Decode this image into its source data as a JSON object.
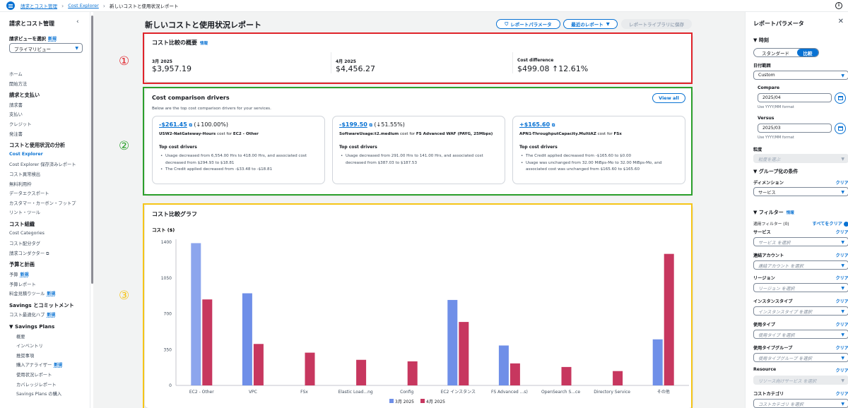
{
  "breadcrumbs": [
    "請求とコスト管理",
    "Cost Explorer",
    "新しいコストと使用状況レポート"
  ],
  "sidebar": {
    "title": "請求とコスト管理",
    "view_label": "請求ビューを選択",
    "new_badge": "新規",
    "view_value": "プライマリビュー",
    "items": [
      {
        "t": "ホーム",
        "k": "i"
      },
      {
        "t": "開始方法",
        "k": "i"
      },
      {
        "t": "請求と支払い",
        "k": "h"
      },
      {
        "t": "請求書",
        "k": "i"
      },
      {
        "t": "支払い",
        "k": "i"
      },
      {
        "t": "クレジット",
        "k": "i"
      },
      {
        "t": "発注書",
        "k": "i"
      },
      {
        "t": "コストと使用状況の分析",
        "k": "h"
      },
      {
        "t": "Cost Explorer",
        "k": "a"
      },
      {
        "t": "Cost Explorer 保存済みレポート",
        "k": "i"
      },
      {
        "t": "コスト異常検出",
        "k": "i"
      },
      {
        "t": "無料利用枠",
        "k": "i"
      },
      {
        "t": "データエクスポート",
        "k": "i"
      },
      {
        "t": "カスタマー・カーボン・フットプ",
        "k": "i"
      },
      {
        "t": "リント・ツール",
        "k": "i"
      },
      {
        "t": "コスト組織",
        "k": "h"
      },
      {
        "t": "Cost Categories",
        "k": "i"
      },
      {
        "t": "コスト配分タグ",
        "k": "i"
      },
      {
        "t": "請求コンダクター",
        "k": "e"
      },
      {
        "t": "予算と計画",
        "k": "h"
      },
      {
        "t": "予算",
        "k": "n"
      },
      {
        "t": "予算レポート",
        "k": "i"
      },
      {
        "t": "料金見積りツール",
        "k": "n"
      },
      {
        "t": "Savings とコミットメント",
        "k": "h"
      },
      {
        "t": "コスト最適化ハブ",
        "k": "n"
      },
      {
        "t": "▼ Savings Plans",
        "k": "hs"
      },
      {
        "t": "概要",
        "k": "s"
      },
      {
        "t": "インベントリ",
        "k": "s"
      },
      {
        "t": "推奨事項",
        "k": "s"
      },
      {
        "t": "購入アナライザー",
        "k": "sn"
      },
      {
        "t": "使用状況レポート",
        "k": "s"
      },
      {
        "t": "カバレッジレポート",
        "k": "s"
      },
      {
        "t": "Savings Plans の購入",
        "k": "s"
      }
    ]
  },
  "page": {
    "title": "新しいコストと使用状況レポート",
    "btn_params": "レポートパラメータ",
    "btn_recent": "最近のレポート",
    "btn_save": "レポートライブラリに保存"
  },
  "annotations": {
    "one": "①",
    "two": "②",
    "three": "③",
    "colors": {
      "one": "#e0242b",
      "two": "#2ca02c",
      "three": "#f5c518"
    }
  },
  "summary": {
    "title": "コスト比較の概要",
    "info": "情報",
    "cols": [
      {
        "label": "3月 2025",
        "value": "$3,957.19"
      },
      {
        "label": "4月 2025",
        "value": "$4,456.27"
      },
      {
        "label": "Cost difference",
        "value": "$499.08 ↑12.61%"
      }
    ]
  },
  "drivers": {
    "title": "Cost comparison drivers",
    "subtitle": "Below are the top cost comparison drivers for your services.",
    "view_all": "View all",
    "section": "Top cost drivers",
    "cards": [
      {
        "amount": "-$261.45",
        "pct": " (↓100.00%)",
        "usage": "USW2-NatGateway-Hours",
        "cost_for": " cost for ",
        "service": "EC2 - Other",
        "bullets": [
          "Usage decreased from 6,554.00 Hrs to 418.00 Hrs, and associated cost decreased from $294.93 to $18.81",
          "The Credit applied decreased from -$33.48 to -$18.81"
        ]
      },
      {
        "amount": "-$199.50",
        "pct": " (↓51.55%)",
        "usage": "SoftwareUsage:t2.medium",
        "cost_for": " cost for ",
        "service": "FS Advanced WAF (PAYG, 25Mbps)",
        "bullets": [
          "Usage decreased from 291.00 Hrs to 141.00 Hrs, and associated cost decreased from $387.03 to $187.53"
        ]
      },
      {
        "amount": "+$165.60",
        "pct": "",
        "usage": "APN1-ThroughputCapacity.MultiAZ",
        "cost_for": " cost for ",
        "service": "FSx",
        "bullets": [
          "The Credit applied decreased from -$165.60 to $0.00",
          "Usage was unchanged from 32.00 MiBps-Mo to 32.00 MiBps-Mo, and associated cost was unchanged from $165.60 to $165.60"
        ]
      }
    ]
  },
  "chart_card": {
    "title": "コスト比較グラフ"
  },
  "chart_data": {
    "type": "bar",
    "ylabel": "コスト ($)",
    "ylim": [
      0,
      1400
    ],
    "yticks": [
      0,
      350,
      700,
      1050,
      1400
    ],
    "categories": [
      "EC2 - Other",
      "VPC",
      "FSx",
      "Elastic Load...ng",
      "Config",
      "EC2 インスタンス",
      "FS Advanced ...s)",
      "OpenSearch S...ce",
      "Directory Service",
      "その他"
    ],
    "series": [
      {
        "name": "3月 2025",
        "color": "#6f8fe8",
        "values": [
          1390,
          900,
          0,
          0,
          0,
          835,
          390,
          0,
          0,
          450
        ]
      },
      {
        "name": "4月 2025",
        "color": "#c7375f",
        "values": [
          840,
          405,
          320,
          250,
          235,
          620,
          215,
          180,
          140,
          1285
        ]
      }
    ],
    "grid": false,
    "legend": "bottom"
  },
  "right_panel": {
    "title": "レポートパラメータ",
    "time_h": "時刻",
    "seg": [
      "スタンダード",
      "比較"
    ],
    "date_range_l": "日付範囲",
    "date_range_v": "Custom",
    "compare_l": "Compare",
    "compare_v": "2025/04",
    "versus_l": "Versus",
    "versus_v": "2025/03",
    "fmt_hint": "Use YYYY/MM format",
    "gran_l": "粒度",
    "gran_v": "粒度を選ぶ",
    "group_h": "グループ化の条件",
    "dim_l": "ディメンション",
    "dim_v": "サービス",
    "clear": "クリア",
    "filter_h": "フィルター",
    "filter_info": "情報",
    "applied_l": "適用フィルター (0)",
    "clear_all": "すべてをクリア",
    "filters": [
      {
        "l": "サービス",
        "p": "サービス を選択"
      },
      {
        "l": "連結アカウント",
        "p": "連結アカウント を選択"
      },
      {
        "l": "リージョン",
        "p": "リージョン を選択"
      },
      {
        "l": "インスタンスタイプ",
        "p": "インスタンスタイプ を選択"
      },
      {
        "l": "使用タイプ",
        "p": "使用タイプ を選択"
      },
      {
        "l": "使用タイプグループ",
        "p": "使用タイプグループ を選択"
      },
      {
        "l": "Resource",
        "p": "リソース向けサービス を選択"
      },
      {
        "l": "コストカテゴリ",
        "p": "コストカテゴリ を選択"
      }
    ]
  }
}
